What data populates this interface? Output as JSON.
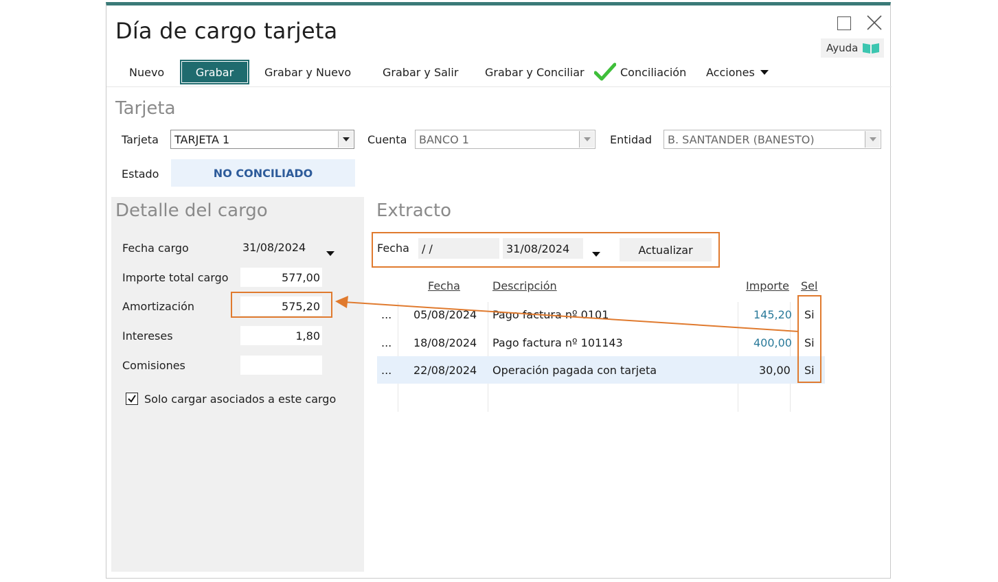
{
  "window": {
    "title": "Día de cargo tarjeta",
    "help_label": "Ayuda"
  },
  "toolbar": {
    "nuevo": "Nuevo",
    "grabar": "Grabar",
    "grabar_y_nuevo": "Grabar y Nuevo",
    "grabar_y_salir": "Grabar y Salir",
    "grabar_y_conciliar": "Grabar y Conciliar",
    "conciliacion": "Conciliación",
    "acciones": "Acciones"
  },
  "tarjeta_section": {
    "title": "Tarjeta",
    "tarjeta_label": "Tarjeta",
    "tarjeta_value": "TARJETA 1",
    "cuenta_label": "Cuenta",
    "cuenta_value": "BANCO 1",
    "entidad_label": "Entidad",
    "entidad_value": "B. SANTANDER (BANESTO)",
    "estado_label": "Estado",
    "estado_value": "NO CONCILIADO"
  },
  "detalle": {
    "title": "Detalle del cargo",
    "fecha_cargo_label": "Fecha cargo",
    "fecha_cargo_value": "31/08/2024",
    "importe_total_label": "Importe total cargo",
    "importe_total_value": "577,00",
    "amortizacion_label": "Amortización",
    "amortizacion_value": "575,20",
    "intereses_label": "Intereses",
    "intereses_value": "1,80",
    "comisiones_label": "Comisiones",
    "comisiones_value": "",
    "solo_cargar_label": "Solo cargar asociados a este cargo"
  },
  "extracto": {
    "title": "Extracto",
    "fecha_label": "Fecha",
    "fecha_desde": " /  /",
    "fecha_hasta": "31/08/2024",
    "actualizar": "Actualizar",
    "columns": {
      "fecha": "Fecha",
      "descripcion": "Descripción",
      "importe": "Importe",
      "sel": "Sel"
    },
    "rows": [
      {
        "dots": "...",
        "fecha": "05/08/2024",
        "descripcion": "Pago factura nº 0101",
        "importe": "145,20",
        "sel": "Si"
      },
      {
        "dots": "...",
        "fecha": "18/08/2024",
        "descripcion": "Pago factura nº 101143",
        "importe": "400,00",
        "sel": "Si"
      },
      {
        "dots": "...",
        "fecha": "22/08/2024",
        "descripcion": "Operación pagada con tarjeta",
        "importe": "30,00",
        "sel": "Si"
      }
    ]
  },
  "colors": {
    "accent": "#1f6b6e",
    "highlight": "#e07a2e",
    "estado": "#2d5b9a",
    "link": "#2a7a9a"
  }
}
